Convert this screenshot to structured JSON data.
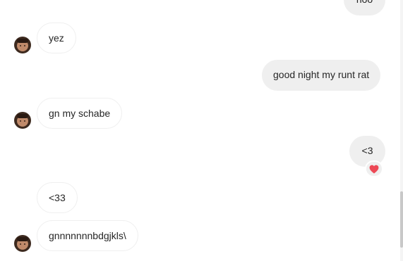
{
  "messages": [
    {
      "direction": "outgoing",
      "text": "noo"
    },
    {
      "direction": "incoming",
      "text": "yez",
      "avatar": true
    },
    {
      "direction": "outgoing",
      "text": "good night my runt rat"
    },
    {
      "direction": "incoming",
      "text": "gn my schabe",
      "avatar": true
    },
    {
      "direction": "outgoing",
      "text": "<3",
      "reaction": "heart-icon"
    },
    {
      "direction": "incoming",
      "text": "<33",
      "avatar": false
    },
    {
      "direction": "incoming",
      "text": "gnnnnnnnbdgjkls\\",
      "avatar": true
    }
  ],
  "colors": {
    "incoming_bubble_bg": "#ffffff",
    "incoming_bubble_border": "#efefef",
    "outgoing_bubble_bg": "#efefef",
    "text": "#262626",
    "reaction_heart": "#ed4956"
  }
}
